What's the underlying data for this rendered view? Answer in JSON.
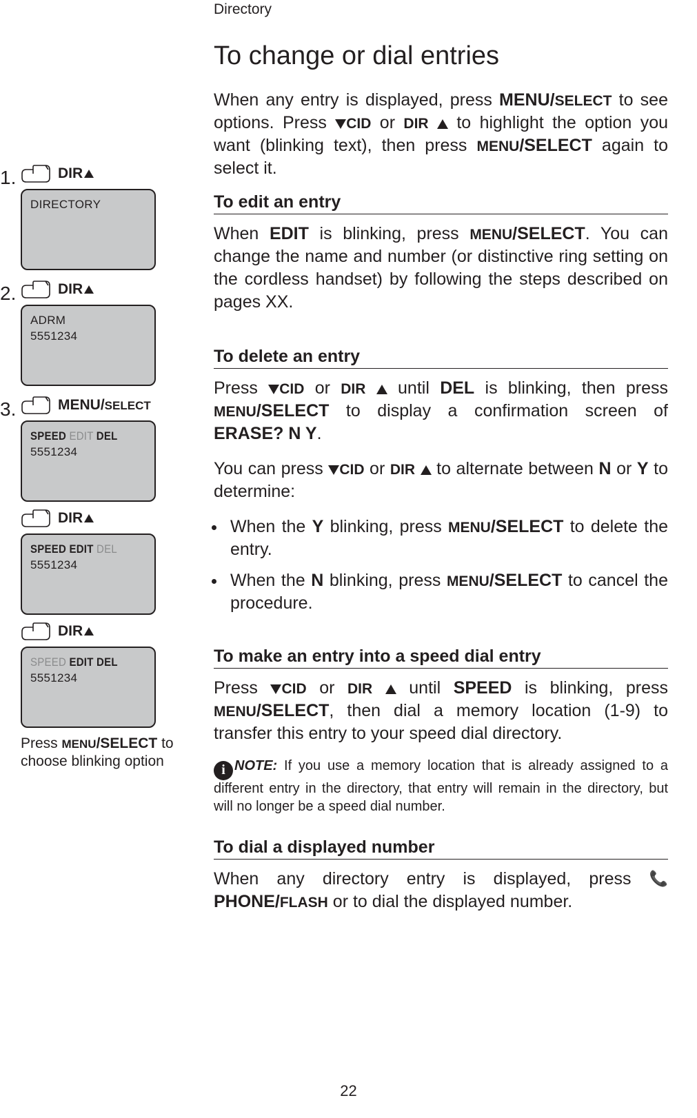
{
  "header": {
    "section": "Directory"
  },
  "main": {
    "title": "To change or dial entries",
    "intro_parts": {
      "p1": "When any entry is displayed, press ",
      "menu_select_1a": "MENU/",
      "menu_select_1b": "SELECT",
      "p2": " to see options. Press ",
      "cid": "CID",
      "or": "  or ",
      "dir": "DIR",
      "p3": " to highlight the option you want (blinking text), then press ",
      "menu_select_2a": "MENU",
      "menu_select_2b": "/SELECT",
      "p4": " again to select it."
    },
    "edit": {
      "heading": "To edit an entry",
      "body_parts": {
        "p1": "When ",
        "edit": "EDIT",
        "p2": " is blinking, press ",
        "ms_a": "MENU",
        "ms_b": "/SELECT",
        "p3": ". You can change the name and number (or distinctive ring setting on the cordless handset) by following the steps described on pages XX."
      }
    },
    "delete": {
      "heading": "To delete an entry",
      "p1_parts": {
        "a": "Press ",
        "cid": "CID",
        "or": "  or ",
        "dir": "DIR",
        "b": " until ",
        "del": "DEL",
        "c": " is blinking, then press ",
        "ms_a": "MENU",
        "ms_b": "/SELECT",
        "d": " to display a confirmation screen of ",
        "erase": "ERASE? N Y",
        "e": "."
      },
      "p2_parts": {
        "a": "You can press ",
        "cid": "CID",
        "or": "  or ",
        "dir": "DIR",
        "b": " to alternate between ",
        "n": "N",
        "or2": " or ",
        "y": "Y",
        "c": " to determine:"
      },
      "bullets": [
        {
          "a": "When the ",
          "key": "Y",
          "b": " blinking, press ",
          "ms_a": "MENU",
          "ms_b": "/SELECT",
          "c": " to delete the entry."
        },
        {
          "a": "When the ",
          "key": "N",
          "b": " blinking, press ",
          "ms_a": "MENU",
          "ms_b": "/SELECT",
          "c": " to cancel the procedure."
        }
      ]
    },
    "speed": {
      "heading": "To make an entry into a speed dial entry",
      "body_parts": {
        "a": "Press ",
        "cid": "CID",
        "or": "  or ",
        "dir": "DIR",
        "b": " until ",
        "speed": "SPEED",
        "c": " is blinking, press ",
        "ms_a": "MENU",
        "ms_b": "/SELECT",
        "d": ", then dial a memory location (1-9) to transfer this entry to your speed dial directory."
      },
      "note_label": "NOTE:",
      "note_text": " If you use a memory location that is already assigned to a different entry in the directory, that entry will remain in the directory, but will no longer be a speed dial number."
    },
    "dial": {
      "heading": "To dial a displayed number",
      "body_parts": {
        "a": "When any directory entry is displayed, press ",
        "phone_a": "PHONE/",
        "phone_b": "FLASH",
        "b": " or to dial the displayed number."
      }
    }
  },
  "side": {
    "steps": [
      {
        "num": "1.",
        "button_label": "DIR",
        "screen": {
          "line1": "DIRECTORY",
          "line2": ""
        }
      },
      {
        "num": "2.",
        "button_label": "DIR",
        "screen": {
          "line1": "ADRM",
          "line2": "5551234"
        }
      },
      {
        "num": "3.",
        "button_label_a": "MENU/",
        "button_label_b": "SELECT"
      }
    ],
    "step3_screens": [
      {
        "btn": "MENU/SELECT",
        "speed": "SPEED",
        "edit": " EDIT ",
        "del": "DEL",
        "num": "5551234",
        "dim_edit": true,
        "dim_speed": false,
        "dim_del": false
      },
      {
        "btn": "DIR",
        "speed": "SPEED ",
        "edit": "EDIT",
        "del": " DEL",
        "num": "5551234",
        "dim_edit": false,
        "dim_speed": false,
        "dim_del": true
      },
      {
        "btn": "DIR",
        "speed": "SPEED",
        "edit": " EDIT ",
        "del": "DEL",
        "num": "5551234",
        "dim_edit": false,
        "dim_speed": true,
        "dim_del": false,
        "hide_speed_style": true
      }
    ],
    "caption_parts": {
      "a": "Press ",
      "ms_a": "MENU",
      "ms_b": "/SELECT",
      "b": " to choose blinking option"
    }
  },
  "page_number": "22"
}
